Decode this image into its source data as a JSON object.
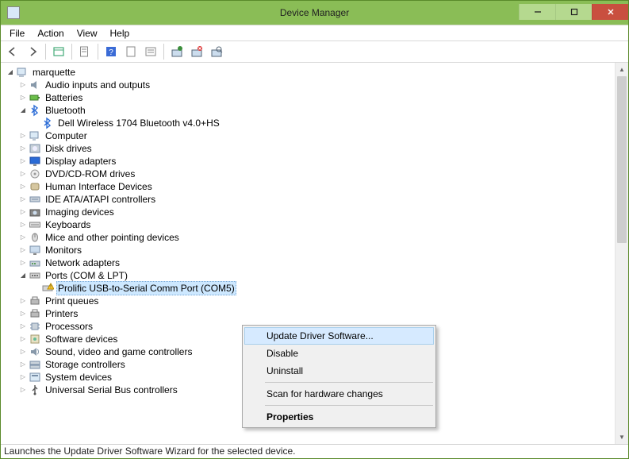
{
  "window": {
    "title": "Device Manager"
  },
  "menus": {
    "file": "File",
    "action": "Action",
    "view": "View",
    "help": "Help"
  },
  "toolbar_icons": [
    "back",
    "forward",
    "show-hidden",
    "properties",
    "help",
    "update",
    "legacy",
    "scan",
    "uninstall",
    "enable"
  ],
  "tree": {
    "root": {
      "label": "marquette",
      "expanded": true
    },
    "items": [
      {
        "label": "Audio inputs and outputs",
        "icon": "audio",
        "expanded": false
      },
      {
        "label": "Batteries",
        "icon": "battery",
        "expanded": false
      },
      {
        "label": "Bluetooth",
        "icon": "bluetooth",
        "expanded": true,
        "children": [
          {
            "label": "Dell Wireless 1704 Bluetooth v4.0+HS",
            "icon": "bluetooth"
          }
        ]
      },
      {
        "label": "Computer",
        "icon": "computer",
        "expanded": false
      },
      {
        "label": "Disk drives",
        "icon": "disk",
        "expanded": false
      },
      {
        "label": "Display adapters",
        "icon": "display",
        "expanded": false
      },
      {
        "label": "DVD/CD-ROM drives",
        "icon": "optical",
        "expanded": false
      },
      {
        "label": "Human Interface Devices",
        "icon": "hid",
        "expanded": false
      },
      {
        "label": "IDE ATA/ATAPI controllers",
        "icon": "ide",
        "expanded": false
      },
      {
        "label": "Imaging devices",
        "icon": "imaging",
        "expanded": false
      },
      {
        "label": "Keyboards",
        "icon": "keyboard",
        "expanded": false
      },
      {
        "label": "Mice and other pointing devices",
        "icon": "mouse",
        "expanded": false
      },
      {
        "label": "Monitors",
        "icon": "monitor",
        "expanded": false
      },
      {
        "label": "Network adapters",
        "icon": "network",
        "expanded": false
      },
      {
        "label": "Ports (COM & LPT)",
        "icon": "port",
        "expanded": true,
        "children": [
          {
            "label": "Prolific USB-to-Serial Comm Port (COM5)",
            "icon": "port-warn",
            "selected": true
          }
        ]
      },
      {
        "label": "Print queues",
        "icon": "printer",
        "expanded": false
      },
      {
        "label": "Printers",
        "icon": "printer",
        "expanded": false
      },
      {
        "label": "Processors",
        "icon": "cpu",
        "expanded": false
      },
      {
        "label": "Software devices",
        "icon": "software",
        "expanded": false
      },
      {
        "label": "Sound, video and game controllers",
        "icon": "sound",
        "expanded": false
      },
      {
        "label": "Storage controllers",
        "icon": "storage",
        "expanded": false
      },
      {
        "label": "System devices",
        "icon": "system",
        "expanded": false
      },
      {
        "label": "Universal Serial Bus controllers",
        "icon": "usb",
        "expanded": false
      }
    ]
  },
  "context_menu": {
    "update": "Update Driver Software...",
    "disable": "Disable",
    "uninstall": "Uninstall",
    "scan": "Scan for hardware changes",
    "properties": "Properties"
  },
  "statusbar": "Launches the Update Driver Software Wizard for the selected device.",
  "colors": {
    "accent": "#8abd56",
    "close": "#c94f3f",
    "select": "#cde8ff",
    "ctx_hover": "#d6eaff"
  }
}
